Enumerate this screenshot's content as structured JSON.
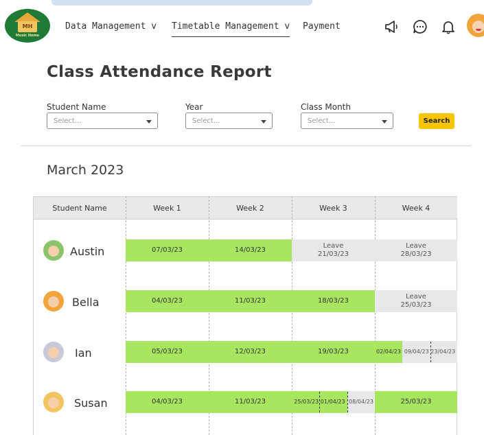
{
  "header": {
    "logo_text": "MH",
    "logo_sub": "Music Home",
    "nav": [
      "Data Management v",
      "Timetable Management v",
      "Payment"
    ],
    "icons": [
      "megaphone-icon",
      "chat-icon",
      "bell-icon"
    ]
  },
  "page": {
    "title": "Class Attendance Report",
    "month": "March 2023"
  },
  "filters": {
    "student_label": "Student Name",
    "year_label": "Year",
    "month_label": "Class Month",
    "student_placeholder": "Select...",
    "year_placeholder": "Select...",
    "month_placeholder": "Select...",
    "search_label": "Search"
  },
  "table": {
    "headers": [
      "Student Name",
      "Week 1",
      "Week 2",
      "Week 3",
      "Week 4"
    ],
    "rows": [
      {
        "name": "Austin",
        "avatar_color": "#8cc46a",
        "segs": [
          {
            "kind": "att",
            "text": "07/03/23"
          },
          {
            "kind": "att",
            "text": "14/03/23"
          },
          {
            "kind": "lv",
            "l1": "Leave",
            "l2": "21/03/23"
          },
          {
            "kind": "lv",
            "l1": "Leave",
            "l2": "28/03/23"
          }
        ]
      },
      {
        "name": "Bella",
        "avatar_color": "#f0a43a",
        "segs": [
          {
            "kind": "att",
            "text": "04/03/23"
          },
          {
            "kind": "att",
            "text": "11/03/23"
          },
          {
            "kind": "att",
            "text": "18/03/23"
          },
          {
            "kind": "lv",
            "l1": "Leave",
            "l2": "25/03/23"
          }
        ]
      },
      {
        "name": "Ian",
        "avatar_color": "#c9c9d9",
        "segs": [
          {
            "kind": "att",
            "text": "05/03/23"
          },
          {
            "kind": "att",
            "text": "12/03/23"
          },
          {
            "kind": "att",
            "text": "19/03/23"
          },
          {
            "kind": "mix",
            "parts": [
              "02/04/23",
              "09/04/23",
              "23/04/23"
            ]
          }
        ]
      },
      {
        "name": "Susan",
        "avatar_color": "#f3c560",
        "segs": [
          {
            "kind": "att",
            "text": "04/03/23"
          },
          {
            "kind": "att",
            "text": "11/03/23"
          },
          {
            "kind": "mix3",
            "parts": [
              "25/03/23",
              "01/04/23",
              "08/04/23"
            ]
          },
          {
            "kind": "att",
            "text": "25/03/23"
          }
        ]
      }
    ]
  },
  "colors": {
    "attended": "#a8e660",
    "leave": "#e8e8e8",
    "accent": "#f7c600"
  }
}
